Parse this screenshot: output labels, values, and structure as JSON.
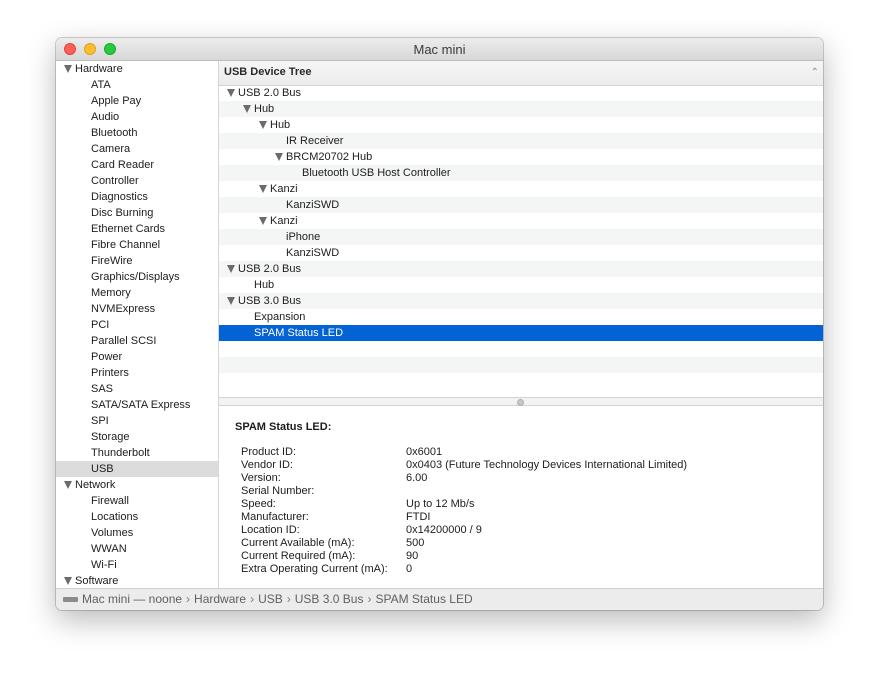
{
  "window": {
    "title": "Mac mini"
  },
  "sidebar": {
    "items": [
      {
        "label": "Hardware",
        "kind": "cat"
      },
      {
        "label": "ATA",
        "kind": "sub"
      },
      {
        "label": "Apple Pay",
        "kind": "sub"
      },
      {
        "label": "Audio",
        "kind": "sub"
      },
      {
        "label": "Bluetooth",
        "kind": "sub"
      },
      {
        "label": "Camera",
        "kind": "sub"
      },
      {
        "label": "Card Reader",
        "kind": "sub"
      },
      {
        "label": "Controller",
        "kind": "sub"
      },
      {
        "label": "Diagnostics",
        "kind": "sub"
      },
      {
        "label": "Disc Burning",
        "kind": "sub"
      },
      {
        "label": "Ethernet Cards",
        "kind": "sub"
      },
      {
        "label": "Fibre Channel",
        "kind": "sub"
      },
      {
        "label": "FireWire",
        "kind": "sub"
      },
      {
        "label": "Graphics/Displays",
        "kind": "sub"
      },
      {
        "label": "Memory",
        "kind": "sub"
      },
      {
        "label": "NVMExpress",
        "kind": "sub"
      },
      {
        "label": "PCI",
        "kind": "sub"
      },
      {
        "label": "Parallel SCSI",
        "kind": "sub"
      },
      {
        "label": "Power",
        "kind": "sub"
      },
      {
        "label": "Printers",
        "kind": "sub"
      },
      {
        "label": "SAS",
        "kind": "sub"
      },
      {
        "label": "SATA/SATA Express",
        "kind": "sub"
      },
      {
        "label": "SPI",
        "kind": "sub"
      },
      {
        "label": "Storage",
        "kind": "sub"
      },
      {
        "label": "Thunderbolt",
        "kind": "sub"
      },
      {
        "label": "USB",
        "kind": "sub",
        "selected": true
      },
      {
        "label": "Network",
        "kind": "cat"
      },
      {
        "label": "Firewall",
        "kind": "sub"
      },
      {
        "label": "Locations",
        "kind": "sub"
      },
      {
        "label": "Volumes",
        "kind": "sub"
      },
      {
        "label": "WWAN",
        "kind": "sub"
      },
      {
        "label": "Wi-Fi",
        "kind": "sub"
      },
      {
        "label": "Software",
        "kind": "cat"
      }
    ]
  },
  "tree": {
    "header": "USB Device Tree",
    "rows": [
      {
        "label": "USB 2.0 Bus",
        "level": 0,
        "expanded": true
      },
      {
        "label": "Hub",
        "level": 1,
        "expanded": true
      },
      {
        "label": "Hub",
        "level": 2,
        "expanded": true
      },
      {
        "label": "IR Receiver",
        "level": 3
      },
      {
        "label": "BRCM20702 Hub",
        "level": 3,
        "expanded": true
      },
      {
        "label": "Bluetooth USB Host Controller",
        "level": 4
      },
      {
        "label": "Kanzi",
        "level": 2,
        "expanded": true
      },
      {
        "label": "KanziSWD",
        "level": 3
      },
      {
        "label": "Kanzi",
        "level": 2,
        "expanded": true
      },
      {
        "label": "iPhone",
        "level": 3
      },
      {
        "label": "KanziSWD",
        "level": 3
      },
      {
        "label": "USB 2.0 Bus",
        "level": 0,
        "expanded": true
      },
      {
        "label": "Hub",
        "level": 1
      },
      {
        "label": "USB 3.0 Bus",
        "level": 0,
        "expanded": true
      },
      {
        "label": "Expansion",
        "level": 1
      },
      {
        "label": "SPAM Status LED",
        "level": 1,
        "selected": true
      },
      {
        "label": "",
        "level": 0
      },
      {
        "label": "",
        "level": 0
      },
      {
        "label": "",
        "level": 0
      }
    ]
  },
  "detail": {
    "title": "SPAM Status LED:",
    "props": [
      {
        "key": "Product ID:",
        "value": "0x6001"
      },
      {
        "key": "Vendor ID:",
        "value": "0x0403  (Future Technology Devices International Limited)"
      },
      {
        "key": "Version:",
        "value": "6.00"
      },
      {
        "key": "Serial Number:",
        "value": ""
      },
      {
        "key": "Speed:",
        "value": "Up to 12 Mb/s"
      },
      {
        "key": "Manufacturer:",
        "value": "FTDI"
      },
      {
        "key": "Location ID:",
        "value": "0x14200000 / 9"
      },
      {
        "key": "Current Available (mA):",
        "value": "500"
      },
      {
        "key": "Current Required (mA):",
        "value": "90"
      },
      {
        "key": "Extra Operating Current (mA):",
        "value": "0"
      }
    ]
  },
  "pathbar": {
    "crumbs": [
      "Mac mini — noone",
      "Hardware",
      "USB",
      "USB 3.0 Bus",
      "SPAM Status LED"
    ]
  },
  "colors": {
    "selection_blue": "#0463d4",
    "sidebar_selection": "#dcdcdc",
    "close": "#fe5f57",
    "minimize": "#febc2e",
    "zoom": "#28c840"
  }
}
